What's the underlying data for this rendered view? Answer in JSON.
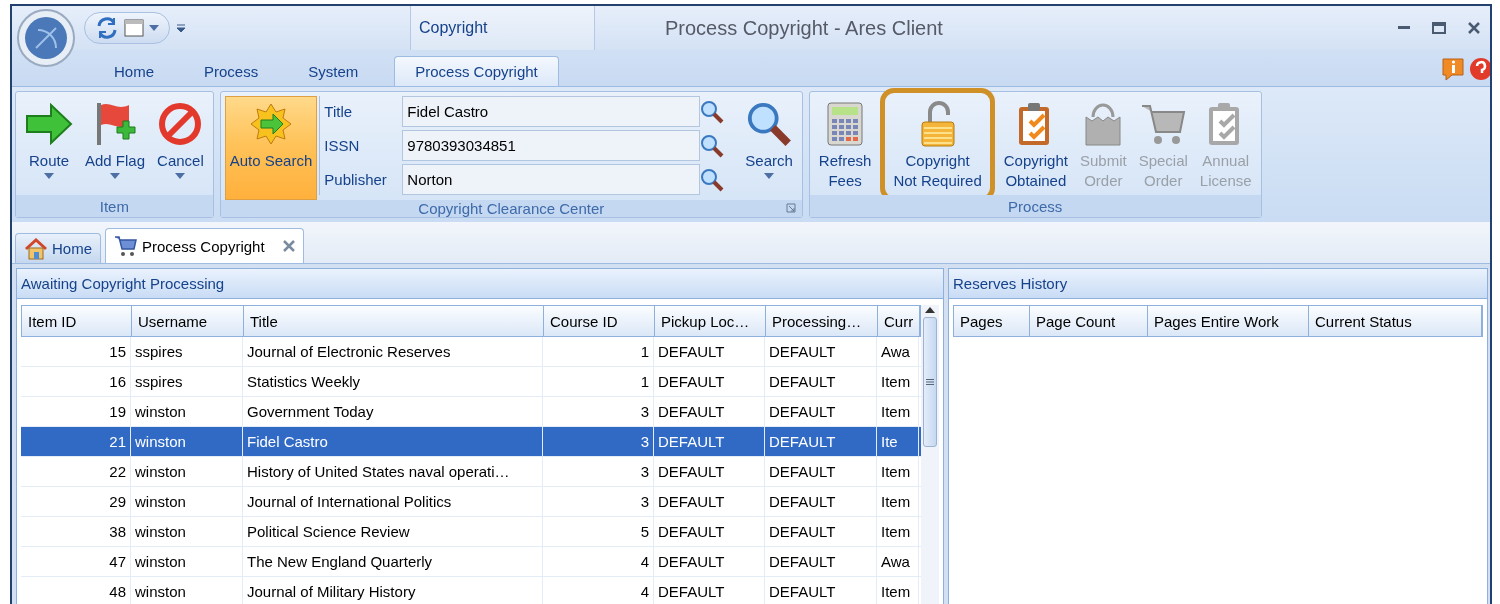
{
  "window": {
    "title": "Process Copyright - Ares Client",
    "context_group": "Copyright"
  },
  "ribbon_tabs": [
    {
      "label": "Home",
      "selected": false
    },
    {
      "label": "Process",
      "selected": false
    },
    {
      "label": "System",
      "selected": false
    },
    {
      "label": "Process Copyright",
      "selected": true
    }
  ],
  "item_group": {
    "label": "Item",
    "buttons": [
      {
        "label": "Route",
        "kind": "arrow",
        "dropdown": true
      },
      {
        "label": "Add Flag",
        "kind": "flag",
        "dropdown": true
      },
      {
        "label": "Cancel",
        "kind": "cancel",
        "dropdown": true
      }
    ]
  },
  "ccc_group": {
    "label": "Copyright Clearance Center",
    "auto_search": {
      "label": "Auto Search",
      "active": true
    },
    "fields": [
      {
        "label": "Title",
        "value": "Fidel Castro"
      },
      {
        "label": "ISSN",
        "value": "9780393034851"
      },
      {
        "label": "Publisher",
        "value": "Norton"
      }
    ],
    "search_button": {
      "label": "Search",
      "dropdown": true
    }
  },
  "process_group": {
    "label": "Process",
    "buttons": [
      {
        "label": "Refresh\nFees",
        "kind": "calculator",
        "disabled": false,
        "highlighted": false
      },
      {
        "label": "Copyright\nNot Required",
        "kind": "lock",
        "disabled": false,
        "highlighted": true
      },
      {
        "label": "Copyright\nObtained",
        "kind": "clipboard",
        "disabled": false,
        "highlighted": false
      },
      {
        "label": "Submit\nOrder",
        "kind": "bag",
        "disabled": true,
        "highlighted": false
      },
      {
        "label": "Special\nOrder",
        "kind": "cart",
        "disabled": true,
        "highlighted": false
      },
      {
        "label": "Annual\nLicense",
        "kind": "clipboard",
        "disabled": true,
        "highlighted": false
      }
    ]
  },
  "doc_tabs": [
    {
      "label": "Home",
      "kind": "house",
      "selected": false,
      "closable": false
    },
    {
      "label": "Process Copyright",
      "kind": "cart",
      "selected": true,
      "closable": true
    }
  ],
  "awaiting_panel": {
    "title": "Awaiting Copyright Processing",
    "columns": [
      "Item ID",
      "Username",
      "Title",
      "Course ID",
      "Pickup Loc…",
      "Processing…",
      "Curr"
    ],
    "rows": [
      {
        "cells": [
          "15",
          "sspires",
          "Journal of Electronic Reserves",
          "1",
          "DEFAULT",
          "DEFAULT",
          "Awa"
        ],
        "selected": false
      },
      {
        "cells": [
          "16",
          "sspires",
          "Statistics Weekly",
          "1",
          "DEFAULT",
          "DEFAULT",
          "Item"
        ],
        "selected": false
      },
      {
        "cells": [
          "19",
          "winston",
          "Government Today",
          "3",
          "DEFAULT",
          "DEFAULT",
          "Item"
        ],
        "selected": false
      },
      {
        "cells": [
          "21",
          "winston",
          "Fidel Castro",
          "3",
          "DEFAULT",
          "DEFAULT",
          "Ite"
        ],
        "selected": true
      },
      {
        "cells": [
          "22",
          "winston",
          "History of United States naval operati…",
          "3",
          "DEFAULT",
          "DEFAULT",
          "Item"
        ],
        "selected": false
      },
      {
        "cells": [
          "29",
          "winston",
          "Journal of International Politics",
          "3",
          "DEFAULT",
          "DEFAULT",
          "Item"
        ],
        "selected": false
      },
      {
        "cells": [
          "38",
          "winston",
          "Political Science Review",
          "5",
          "DEFAULT",
          "DEFAULT",
          "Item"
        ],
        "selected": false
      },
      {
        "cells": [
          "47",
          "winston",
          "The New England Quarterly",
          "4",
          "DEFAULT",
          "DEFAULT",
          "Awa"
        ],
        "selected": false
      },
      {
        "cells": [
          "48",
          "winston",
          "Journal of Military History",
          "4",
          "DEFAULT",
          "DEFAULT",
          "Item"
        ],
        "selected": false
      }
    ]
  },
  "history_panel": {
    "title": "Reserves History",
    "columns": [
      "Pages",
      "Page Count",
      "Pages Entire Work",
      "Current Status"
    ]
  }
}
